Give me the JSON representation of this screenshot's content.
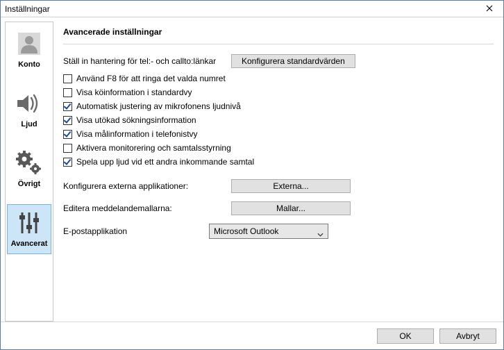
{
  "window": {
    "title": "Inställningar"
  },
  "sidebar": {
    "items": [
      {
        "label": "Konto"
      },
      {
        "label": "Ljud"
      },
      {
        "label": "Övrigt"
      },
      {
        "label": "Avancerat"
      }
    ]
  },
  "content": {
    "title": "Avancerade inställningar",
    "tel_row_label": "Ställ in hantering för tel:- och callto:länkar",
    "tel_row_button": "Konfigurera standardvärden",
    "checks": [
      {
        "label": "Använd F8 för att ringa det valda numret",
        "checked": false
      },
      {
        "label": "Visa köinformation i standardvy",
        "checked": false
      },
      {
        "label": "Automatisk justering av mikrofonens ljudnivå",
        "checked": true
      },
      {
        "label": "Visa utökad sökningsinformation",
        "checked": true
      },
      {
        "label": "Visa målinformation i telefonistvy",
        "checked": true
      },
      {
        "label": "Aktivera monitorering och samtalsstyrning",
        "checked": false
      },
      {
        "label": "Spela upp ljud vid ett andra inkommande samtal",
        "checked": true
      }
    ],
    "ext_apps_label": "Konfigurera externa applikationer:",
    "ext_apps_button": "Externa...",
    "templates_label": "Editera meddelandemallarna:",
    "templates_button": "Mallar...",
    "email_app_label": "E-postapplikation",
    "email_app_value": "Microsoft Outlook"
  },
  "footer": {
    "ok": "OK",
    "cancel": "Avbryt"
  }
}
